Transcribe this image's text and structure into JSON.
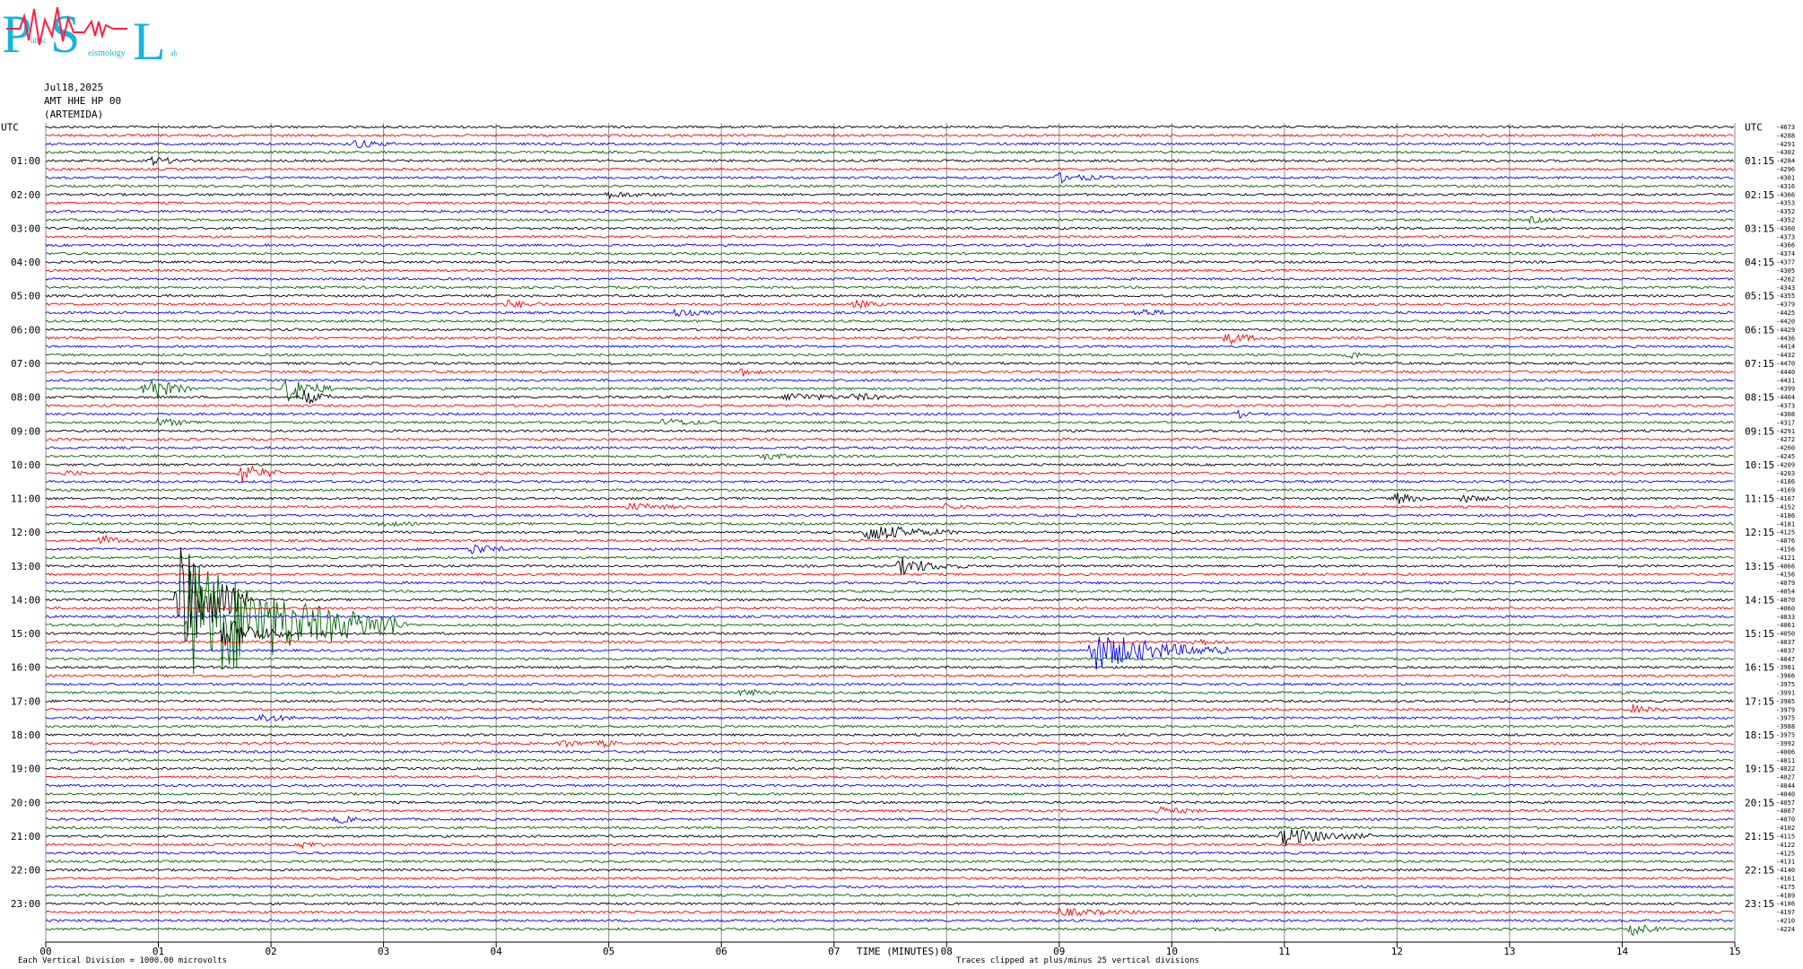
{
  "logo": {
    "letters": [
      "P",
      "S",
      "L"
    ],
    "small_text": [
      "ublic",
      "eismology",
      "ab"
    ]
  },
  "header": {
    "date": "Jul18,2025",
    "channel": "AMT HHE HP 00",
    "station": "(ARTEMIDA)"
  },
  "chart_data": {
    "type": "line",
    "title": "",
    "xlabel": "TIME (MINUTES)",
    "ylabel": "UTC",
    "x_range": [
      0,
      15
    ],
    "x_ticks": [
      "00",
      "01",
      "02",
      "03",
      "04",
      "05",
      "06",
      "07",
      "08",
      "09",
      "10",
      "11",
      "12",
      "13",
      "14",
      "15"
    ],
    "left_hour_labels": [
      "UTC",
      "01:00",
      "02:00",
      "03:00",
      "04:00",
      "05:00",
      "06:00",
      "07:00",
      "08:00",
      "09:00",
      "10:00",
      "11:00",
      "12:00",
      "13:00",
      "14:00",
      "15:00",
      "16:00",
      "17:00",
      "18:00",
      "19:00",
      "20:00",
      "21:00",
      "22:00",
      "23:00"
    ],
    "right_hour_labels": [
      "UTC",
      "01:15",
      "02:15",
      "03:15",
      "04:15",
      "05:15",
      "06:15",
      "07:15",
      "08:15",
      "09:15",
      "10:15",
      "11:15",
      "12:15",
      "13:15",
      "14:15",
      "15:15",
      "16:15",
      "17:15",
      "18:15",
      "19:15",
      "20:15",
      "21:15",
      "22:15",
      "23:15"
    ],
    "trace_colors": [
      "#000000",
      "#ff0000",
      "#0000ff",
      "#006400"
    ],
    "trace_count": 96,
    "trace_interval_minutes": 15,
    "grid": true,
    "offset_values": [
      "-4673",
      "-4288",
      "-4291",
      "-4302",
      "-4284",
      "-4296",
      "-4301",
      "-4316",
      "-4366",
      "-4353",
      "-4352",
      "-4352",
      "-4360",
      "-4373",
      "-4366",
      "-4374",
      "-4377",
      "-4305",
      "-4262",
      "-4343",
      "-4355",
      "-4379",
      "-4425",
      "-4420",
      "-4429",
      "-4436",
      "-4414",
      "-4432",
      "-4470",
      "-4440",
      "-4431",
      "-4399",
      "-4404",
      "-4373",
      "-4308",
      "-4317",
      "-4291",
      "-4272",
      "-4260",
      "-4245",
      "-4209",
      "-4203",
      "-4186",
      "-4169",
      "-4167",
      "-4152",
      "-4186",
      "-4181",
      "-4125",
      "-4076",
      "-4156",
      "-4121",
      "-4066",
      "-4156",
      "-4079",
      "-4054",
      "-4070",
      "-4060",
      "-4033",
      "-4061",
      "-4050",
      "-4037",
      "-4037",
      "-4047",
      "-3981",
      "-3966",
      "-3975",
      "-3991",
      "-3985",
      "-3979",
      "-3975",
      "-3988",
      "-3975",
      "-3992",
      "-4006",
      "-4011",
      "-4022",
      "-4027",
      "-4044",
      "-4040",
      "-4057",
      "-4067",
      "-4070",
      "-4102",
      "-4115",
      "-4122",
      "-4125",
      "-4131",
      "-4140",
      "-4161",
      "-4175",
      "-4189",
      "-4186",
      "-4197",
      "-4210",
      "-4224"
    ],
    "events": [
      {
        "trace": 2,
        "minute": 2.75,
        "amp": 5,
        "dur": 0.35
      },
      {
        "trace": 4,
        "minute": 0.95,
        "amp": 4,
        "dur": 0.4
      },
      {
        "trace": 6,
        "minute": 9.0,
        "amp": 5,
        "dur": 0.5
      },
      {
        "trace": 8,
        "minute": 5.0,
        "amp": 3,
        "dur": 0.6
      },
      {
        "trace": 11,
        "minute": 13.2,
        "amp": 3,
        "dur": 0.3
      },
      {
        "trace": 21,
        "minute": 4.1,
        "amp": 4,
        "dur": 0.4
      },
      {
        "trace": 22,
        "minute": 5.6,
        "amp": 4,
        "dur": 0.4
      },
      {
        "trace": 21,
        "minute": 7.2,
        "amp": 4,
        "dur": 0.3
      },
      {
        "trace": 22,
        "minute": 9.7,
        "amp": 4,
        "dur": 0.4
      },
      {
        "trace": 25,
        "minute": 10.5,
        "amp": 6,
        "dur": 0.4
      },
      {
        "trace": 27,
        "minute": 11.6,
        "amp": 4,
        "dur": 0.2
      },
      {
        "trace": 29,
        "minute": 6.2,
        "amp": 4,
        "dur": 0.2
      },
      {
        "trace": 31,
        "minute": 0.9,
        "amp": 16,
        "dur": 0.4
      },
      {
        "trace": 31,
        "minute": 2.15,
        "amp": 16,
        "dur": 0.4
      },
      {
        "trace": 32,
        "minute": 2.3,
        "amp": 8,
        "dur": 0.3
      },
      {
        "trace": 32,
        "minute": 6.6,
        "amp": 5,
        "dur": 0.6
      },
      {
        "trace": 32,
        "minute": 7.2,
        "amp": 4,
        "dur": 0.4
      },
      {
        "trace": 34,
        "minute": 10.6,
        "amp": 4,
        "dur": 0.1
      },
      {
        "trace": 35,
        "minute": 1.0,
        "amp": 4,
        "dur": 0.5
      },
      {
        "trace": 35,
        "minute": 5.5,
        "amp": 4,
        "dur": 0.5
      },
      {
        "trace": 39,
        "minute": 6.4,
        "amp": 4,
        "dur": 0.3
      },
      {
        "trace": 41,
        "minute": 1.75,
        "amp": 12,
        "dur": 0.35
      },
      {
        "trace": 41,
        "minute": 0.2,
        "amp": 3,
        "dur": 0.2
      },
      {
        "trace": 44,
        "minute": 12.0,
        "amp": 6,
        "dur": 0.3
      },
      {
        "trace": 44,
        "minute": 12.6,
        "amp": 4,
        "dur": 0.3
      },
      {
        "trace": 45,
        "minute": 5.2,
        "amp": 4,
        "dur": 0.5
      },
      {
        "trace": 45,
        "minute": 8.0,
        "amp": 3,
        "dur": 0.4
      },
      {
        "trace": 47,
        "minute": 3.0,
        "amp": 3,
        "dur": 0.3
      },
      {
        "trace": 48,
        "minute": 7.3,
        "amp": 10,
        "dur": 0.8
      },
      {
        "trace": 49,
        "minute": 0.5,
        "amp": 6,
        "dur": 0.3
      },
      {
        "trace": 50,
        "minute": 3.8,
        "amp": 7,
        "dur": 0.3
      },
      {
        "trace": 52,
        "minute": 7.6,
        "amp": 9,
        "dur": 0.6
      },
      {
        "trace": 56,
        "minute": 1.2,
        "amp": 70,
        "dur": 0.6
      },
      {
        "trace": 59,
        "minute": 1.3,
        "amp": 80,
        "dur": 1.8
      },
      {
        "trace": 60,
        "minute": 1.6,
        "amp": 18,
        "dur": 0.6
      },
      {
        "trace": 59,
        "minute": 3.1,
        "amp": 5,
        "dur": 0.2
      },
      {
        "trace": 62,
        "minute": 9.3,
        "amp": 22,
        "dur": 1.2
      },
      {
        "trace": 61,
        "minute": 10.2,
        "amp": 4,
        "dur": 0.3
      },
      {
        "trace": 67,
        "minute": 6.2,
        "amp": 4,
        "dur": 0.3
      },
      {
        "trace": 70,
        "minute": 1.9,
        "amp": 5,
        "dur": 0.4
      },
      {
        "trace": 69,
        "minute": 14.1,
        "amp": 5,
        "dur": 0.3
      },
      {
        "trace": 73,
        "minute": 4.6,
        "amp": 4,
        "dur": 0.3
      },
      {
        "trace": 73,
        "minute": 4.95,
        "amp": 4,
        "dur": 0.2
      },
      {
        "trace": 81,
        "minute": 9.9,
        "amp": 4,
        "dur": 0.4
      },
      {
        "trace": 82,
        "minute": 2.6,
        "amp": 4,
        "dur": 0.3
      },
      {
        "trace": 84,
        "minute": 11.0,
        "amp": 10,
        "dur": 0.8
      },
      {
        "trace": 85,
        "minute": 2.3,
        "amp": 4,
        "dur": 0.2
      },
      {
        "trace": 93,
        "minute": 9.0,
        "amp": 4,
        "dur": 0.8
      },
      {
        "trace": 95,
        "minute": 14.1,
        "amp": 6,
        "dur": 0.3
      },
      {
        "trace": 95,
        "minute": 10.4,
        "amp": 3,
        "dur": 0.1
      }
    ]
  },
  "footer": {
    "left": "Each Vertical Division = 1000.00 microvolts",
    "right": "Traces clipped at plus/minus 25 vertical divisions"
  }
}
